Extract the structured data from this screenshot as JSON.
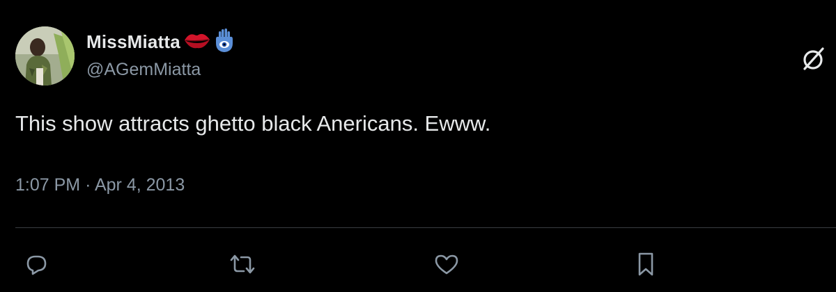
{
  "tweet": {
    "display_name": "MissMiatta",
    "handle": "@AGemMiatta",
    "text": "This show attracts ghetto black Anericans. Ewww.",
    "time": "1:07 PM",
    "separator": "·",
    "date": "Apr 4, 2013"
  },
  "icons": {
    "name_emojis": [
      "kiss-mark-icon",
      "hamsa-icon"
    ],
    "top_right": "grok-icon",
    "actions": [
      "reply-icon",
      "retweet-icon",
      "like-icon",
      "bookmark-icon"
    ]
  },
  "colors": {
    "background": "#000000",
    "primary_text": "#e7e9ea",
    "secondary_text": "#8b98a5",
    "divider": "#3a3d41",
    "kiss": "#d3142a",
    "hamsa": "#5b8fd8"
  }
}
